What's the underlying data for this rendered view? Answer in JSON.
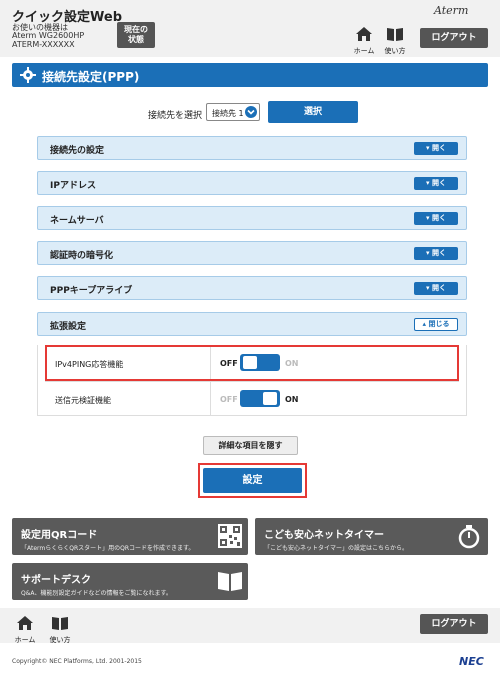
{
  "header": {
    "app_title": "クイック設定Web",
    "device_line1": "お使いの機器は",
    "device_line2": "Aterm WG2600HP",
    "device_line3": "ATERM-XXXXXX",
    "status_btn_line1": "現在の",
    "status_btn_line2": "状態",
    "logo": "Aterm",
    "home_label": "ホーム",
    "howto_label": "使い方",
    "logout_label": "ログアウト"
  },
  "page": {
    "title": "接続先設定(PPP)",
    "select_label": "接続先を選択",
    "select_value": "接続先 1",
    "select_button": "選択"
  },
  "sections": [
    {
      "label": "接続先の設定",
      "toggle": "開く"
    },
    {
      "label": "IPアドレス",
      "toggle": "開く"
    },
    {
      "label": "ネームサーバ",
      "toggle": "開く"
    },
    {
      "label": "認証時の暗号化",
      "toggle": "開く"
    },
    {
      "label": "PPPキープアライブ",
      "toggle": "開く"
    },
    {
      "label": "拡張設定",
      "toggle": "閉じる"
    }
  ],
  "extended": {
    "rows": [
      {
        "label": "IPv4PING応答機能",
        "off": "OFF",
        "on": "ON",
        "state": "OFF"
      },
      {
        "label": "送信元検証機能",
        "off": "OFF",
        "on": "ON",
        "state": "ON"
      }
    ]
  },
  "actions": {
    "hide_details": "詳細な項目を隠す",
    "submit": "設定"
  },
  "cards": {
    "qr_title": "設定用QRコード",
    "qr_sub": "「AtermらくらくQRスタート」用のQRコードを作成できます。",
    "timer_title": "こども安心ネットタイマー",
    "timer_sub": "「こども安心ネットタイマー」の設定はこちらから。",
    "support_title": "サポートデスク",
    "support_sub": "Q&A、機能別設定ガイドなどの情報をご覧になれます。"
  },
  "footer": {
    "home_label": "ホーム",
    "howto_label": "使い方",
    "logout_label": "ログアウト",
    "copyright": "Copyright© NEC Platforms, Ltd. 2001-2015",
    "brand": "NEC"
  },
  "colors": {
    "accent": "#1b6fb7",
    "highlight": "#e53935",
    "section_bg": "#dcecf8"
  }
}
